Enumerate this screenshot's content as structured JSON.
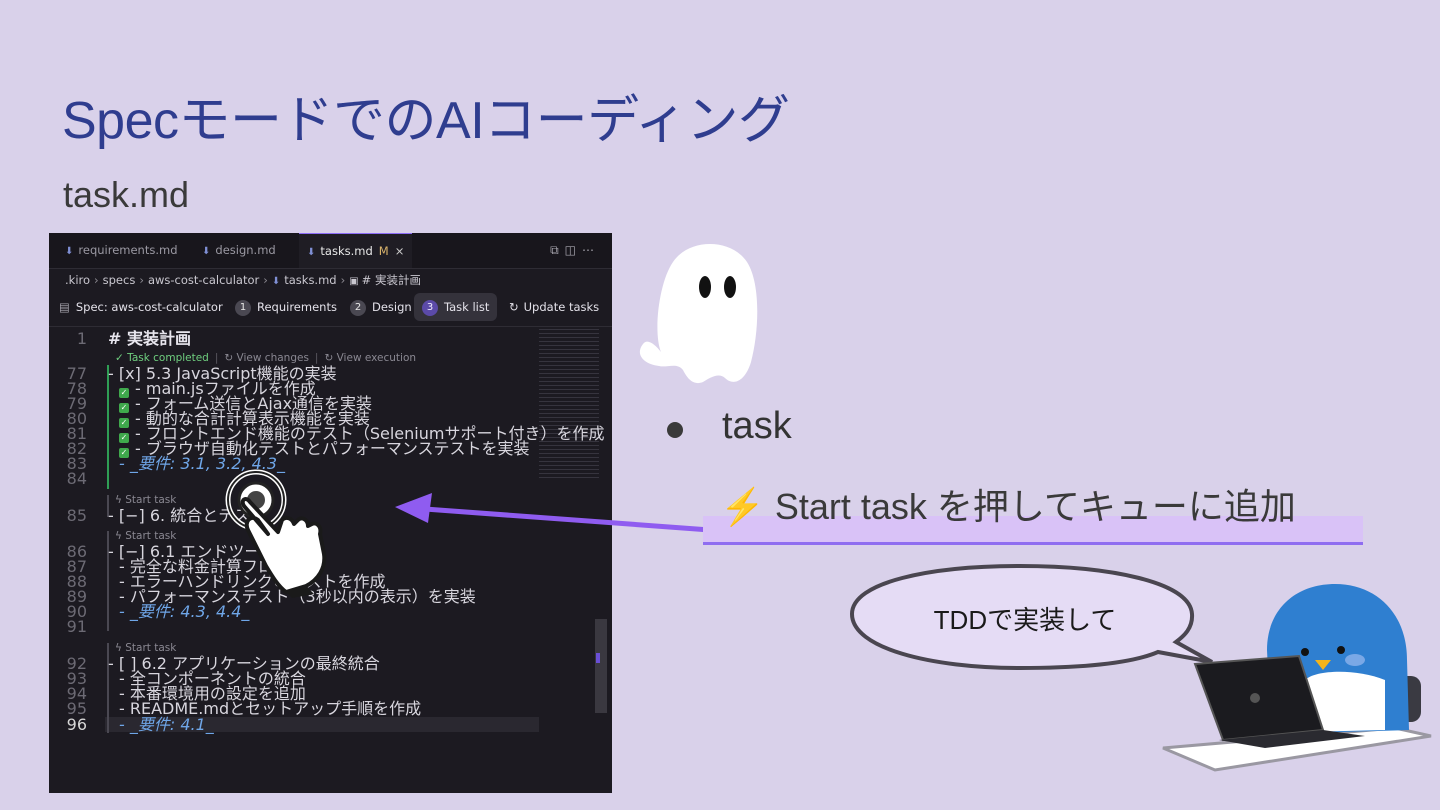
{
  "slide": {
    "title": "SpecモードでのAIコーディング",
    "subtitle": "task.md"
  },
  "editor": {
    "tabs": [
      {
        "label": "requirements.md",
        "icon": "markdown-icon"
      },
      {
        "label": "design.md",
        "icon": "markdown-icon"
      },
      {
        "label": "tasks.md",
        "icon": "markdown-icon",
        "modified": "M",
        "close": "×"
      }
    ],
    "breadcrumb": [
      ".kiro",
      "specs",
      "aws-cost-calculator",
      "tasks.md",
      "# 実装計画"
    ],
    "specbar": {
      "spec_label": "Spec: aws-cost-calculator",
      "steps": [
        {
          "num": "1",
          "label": "Requirements"
        },
        {
          "num": "2",
          "label": "Design"
        },
        {
          "num": "3",
          "label": "Task list"
        }
      ],
      "update": "Update tasks"
    },
    "lines": [
      {
        "n": "1",
        "text": "# 実装計画"
      },
      {
        "n": "77",
        "text": "- [x] 5.3 JavaScript機能の実装"
      },
      {
        "n": "78",
        "text": "- main.jsファイルを作成"
      },
      {
        "n": "79",
        "text": "- フォーム送信とAjax通信を実装"
      },
      {
        "n": "80",
        "text": "- 動的な合計計算表示機能を実装"
      },
      {
        "n": "81",
        "text": "- フロントエンド機能のテスト（Seleniumサポート付き）を作成"
      },
      {
        "n": "82",
        "text": "- ブラウザ自動化テストとパフォーマンステストを実装"
      },
      {
        "n": "83",
        "text": "- _要件: 3.1, 3.2, 4.3_"
      },
      {
        "n": "84",
        "text": ""
      },
      {
        "n": "85",
        "text": "- [−] 6. 統合とテスト"
      },
      {
        "n": "86",
        "text": "- [−] 6.1 エンドツーエンドテ"
      },
      {
        "n": "87",
        "text": "- 完全な料金計算フローのテ"
      },
      {
        "n": "88",
        "text": "- エラーハンドリングのテストを作成"
      },
      {
        "n": "89",
        "text": "- パフォーマンステスト（3秒以内の表示）を実装"
      },
      {
        "n": "90",
        "text": "- _要件: 4.3, 4.4_"
      },
      {
        "n": "91",
        "text": ""
      },
      {
        "n": "92",
        "text": "- [ ] 6.2 アプリケーションの最終統合"
      },
      {
        "n": "93",
        "text": "- 全コンポーネントの統合"
      },
      {
        "n": "94",
        "text": "- 本番環境用の設定を追加"
      },
      {
        "n": "95",
        "text": "- README.mdとセットアップ手順を作成"
      },
      {
        "n": "96",
        "text": "- _要件: 4.1_"
      }
    ],
    "lens": {
      "completed": "Task completed",
      "view_changes": "View changes",
      "view_execution": "View execution",
      "start_task": "Start task"
    }
  },
  "bullets": {
    "main": "task",
    "sub_icon": "⚡",
    "sub": "Start task を押してキューに追加"
  },
  "bubble": {
    "text": "TDDで実装して"
  },
  "colors": {
    "background": "#d9d1ea",
    "title": "#2f3d8f",
    "arrow": "#8f5cf0",
    "editor_bg": "#1c1a21"
  }
}
